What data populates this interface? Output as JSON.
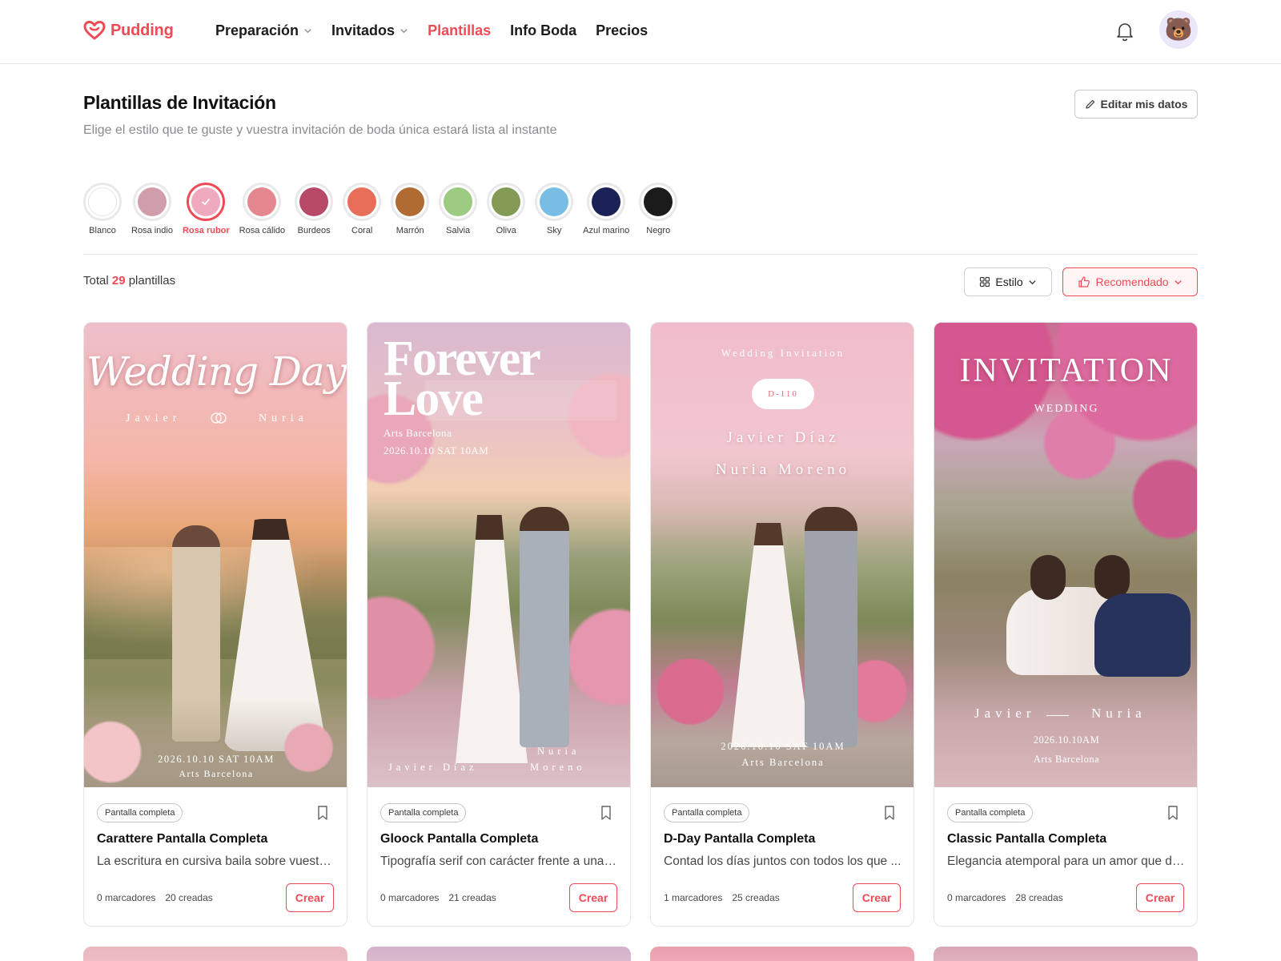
{
  "brand": {
    "name": "Pudding",
    "accent": "#ef4a55"
  },
  "nav": {
    "items": [
      {
        "label": "Preparación",
        "dropdown": true,
        "active": false
      },
      {
        "label": "Invitados",
        "dropdown": true,
        "active": false
      },
      {
        "label": "Plantillas",
        "dropdown": false,
        "active": true
      },
      {
        "label": "Info Boda",
        "dropdown": false,
        "active": false
      },
      {
        "label": "Precios",
        "dropdown": false,
        "active": false
      }
    ]
  },
  "header": {
    "avatar_emoji": "🐻"
  },
  "page": {
    "title": "Plantillas de Invitación",
    "subtitle": "Elige el estilo que te guste y vuestra invitación de boda única estará lista al instante",
    "edit_button": "Editar mis datos"
  },
  "swatches": [
    {
      "label": "Blanco",
      "color": "#ffffff",
      "selected": false
    },
    {
      "label": "Rosa indio",
      "color": "#cf9ea8",
      "selected": false
    },
    {
      "label": "Rosa rubor",
      "color": "#efaabf",
      "selected": true
    },
    {
      "label": "Rosa cálido",
      "color": "#e4878f",
      "selected": false
    },
    {
      "label": "Burdeos",
      "color": "#b94a67",
      "selected": false
    },
    {
      "label": "Coral",
      "color": "#e86e5a",
      "selected": false
    },
    {
      "label": "Marrón",
      "color": "#b06b33",
      "selected": false
    },
    {
      "label": "Salvia",
      "color": "#9ccb82",
      "selected": false
    },
    {
      "label": "Oliva",
      "color": "#859a55",
      "selected": false
    },
    {
      "label": "Sky",
      "color": "#78bde4",
      "selected": false
    },
    {
      "label": "Azul marino",
      "color": "#1a2256",
      "selected": false
    },
    {
      "label": "Negro",
      "color": "#1b1b1b",
      "selected": false
    }
  ],
  "results": {
    "prefix": "Total",
    "count": "29",
    "suffix": "plantillas"
  },
  "filters": {
    "style_label": "Estilo",
    "sort_label": "Recomendado"
  },
  "cards": [
    {
      "badge": "Pantalla completa",
      "title": "Carattere Pantalla Completa",
      "description": "La escritura en cursiva baila sobre vuestra...",
      "bookmarks": "0 marcadores",
      "created": "20 creadas",
      "button": "Crear",
      "overlay": {
        "headline": "Wedding Day",
        "name1": "Javier",
        "name2": "Nuria",
        "date": "2026.10.10 SAT 10AM",
        "venue": "Arts Barcelona"
      }
    },
    {
      "badge": "Pantalla completa",
      "title": "Gloock Pantalla Completa",
      "description": "Tipografía serif con carácter frente a una f...",
      "bookmarks": "0 marcadores",
      "created": "21 creadas",
      "button": "Crear",
      "overlay": {
        "headline1": "Forever",
        "headline2": "Love",
        "venue": "Arts Barcelona",
        "date": "2026.10.10 SAT 10AM",
        "name1": "Javier Díaz",
        "name2a": "Nuria",
        "name2b": "Moreno"
      }
    },
    {
      "badge": "Pantalla completa",
      "title": "D-Day Pantalla Completa",
      "description": "Contad los días juntos con todos los que ...",
      "bookmarks": "1 marcadores",
      "created": "25 creadas",
      "button": "Crear",
      "overlay": {
        "kicker": "Wedding Invitation",
        "countdown": "D-110",
        "name1": "Javier Díaz",
        "name2": "Nuria Moreno",
        "date": "2026.10.10 SAT 10AM",
        "venue": "Arts Barcelona"
      }
    },
    {
      "badge": "Pantalla completa",
      "title": "Classic Pantalla Completa",
      "description": "Elegancia atemporal para un amor que du...",
      "bookmarks": "0 marcadores",
      "created": "28 creadas",
      "button": "Crear",
      "overlay": {
        "headline": "INVITATION",
        "kicker": "WEDDING",
        "name1": "Javier",
        "name2": "Nuria",
        "date": "2026.10.10AM",
        "venue": "Arts Barcelona"
      }
    }
  ]
}
